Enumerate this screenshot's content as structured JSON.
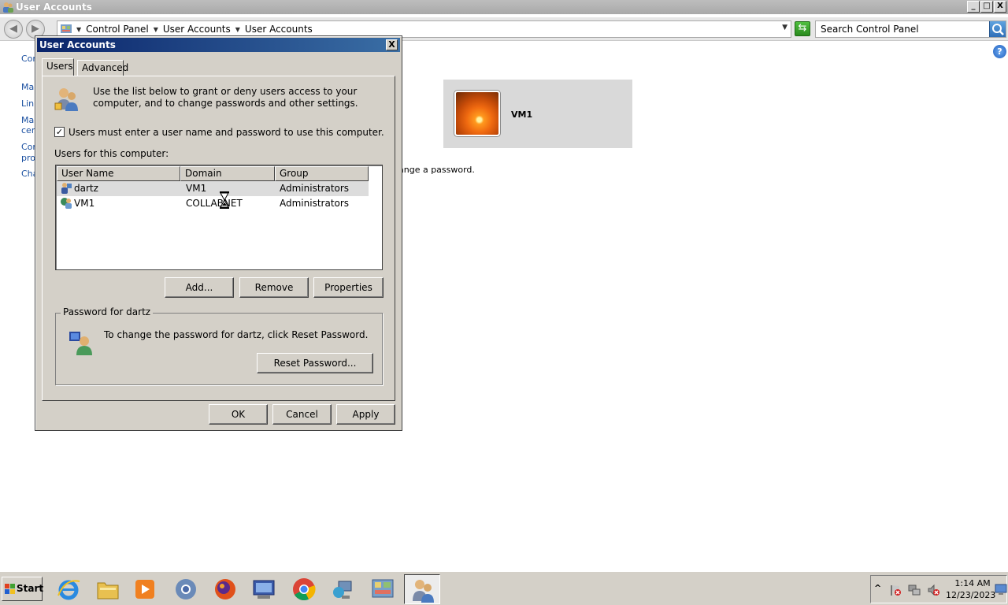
{
  "window": {
    "title": "User Accounts",
    "minimize": "_",
    "maximize": "□",
    "close": "X"
  },
  "address_bar": {
    "breadcrumbs": [
      "Control Panel",
      "User Accounts",
      "User Accounts"
    ],
    "search_placeholder": "Search Control Panel"
  },
  "left_links": [
    "Cor",
    "Mar",
    "Link",
    "Mar",
    "cert",
    "Cor",
    "pro",
    "Cha"
  ],
  "background": {
    "user_card_name": "VM1",
    "partial_text": "ange a password."
  },
  "dialog": {
    "title": "User Accounts",
    "close": "X",
    "tabs": [
      "Users",
      "Advanced"
    ],
    "intro_text": "Use the list below to grant or deny users access to your computer, and to change passwords and other settings.",
    "checkbox_label": "Users must enter a user name and password to use this computer.",
    "checkbox_checked": true,
    "checkbox_mark": "✓",
    "list_label": "Users for this computer:",
    "columns": [
      "User Name",
      "Domain",
      "Group"
    ],
    "users": [
      {
        "name": "dartz",
        "domain": "VM1",
        "group": "Administrators"
      },
      {
        "name": "VM1",
        "domain": "COLLABNET",
        "group": "Administrators"
      }
    ],
    "buttons": {
      "add": "Add...",
      "remove": "Remove",
      "properties": "Properties"
    },
    "password_group": {
      "title": "Password for dartz",
      "text": "To change the password for dartz, click Reset Password.",
      "reset_button": "Reset Password..."
    },
    "footer": {
      "ok": "OK",
      "cancel": "Cancel",
      "apply": "Apply"
    }
  },
  "taskbar": {
    "start_label": "Start",
    "apps": [
      "internet-explorer",
      "file-explorer",
      "media-player",
      "chromium",
      "firefox",
      "remote-desktop",
      "chrome",
      "network",
      "control-panel",
      "user-accounts"
    ],
    "tray_chevron": "^",
    "time": "1:14 AM",
    "date": "12/23/2023"
  },
  "help": "?",
  "colors": {
    "dialog_title": "#0a246a",
    "link": "#1a4fa0",
    "selection": "#dcdcdc"
  }
}
